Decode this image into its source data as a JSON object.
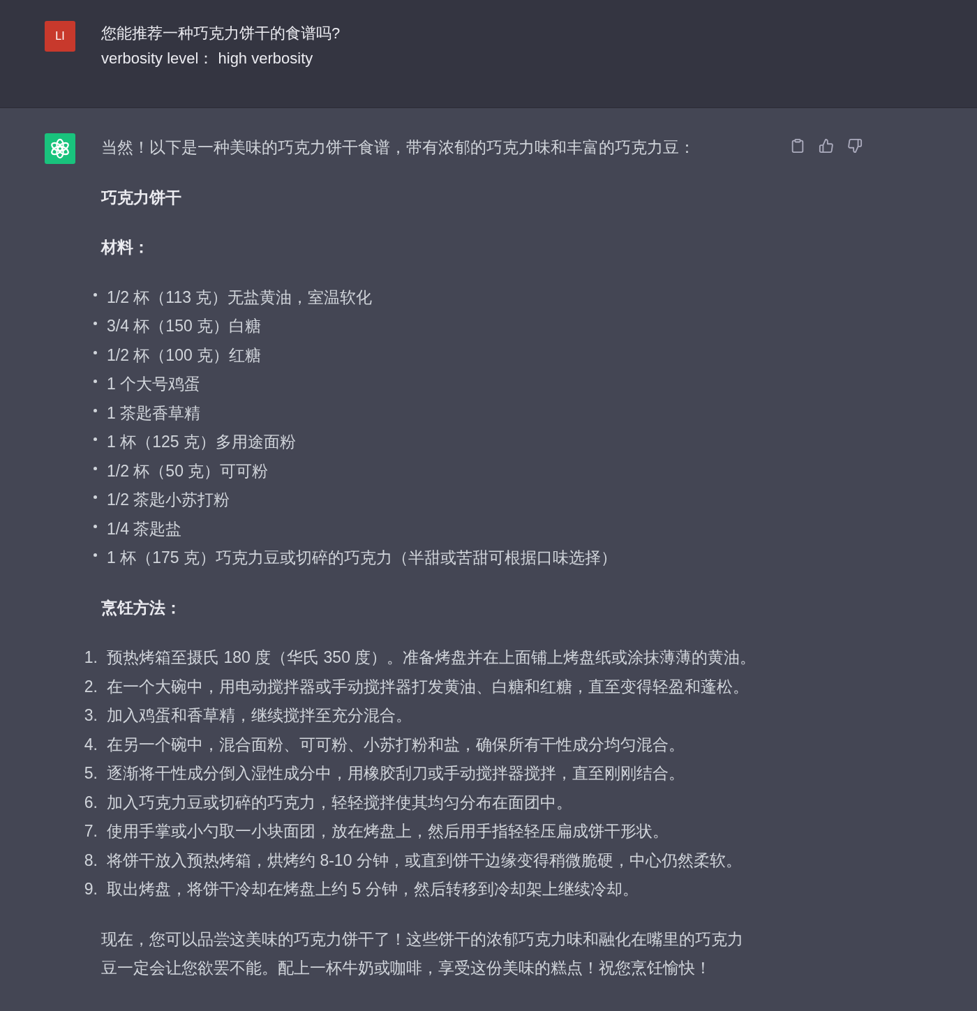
{
  "user_message": {
    "avatar_initials": "LI",
    "lines": [
      "您能推荐一种巧克力饼干的食谱吗?",
      "verbosity level： high verbosity"
    ]
  },
  "assistant_message": {
    "intro": "当然！以下是一种美味的巧克力饼干食谱，带有浓郁的巧克力味和丰富的巧克力豆：",
    "title": "巧克力饼干",
    "ingredients_heading": "材料：",
    "ingredients": [
      "1/2 杯（113 克）无盐黄油，室温软化",
      "3/4 杯（150 克）白糖",
      "1/2 杯（100 克）红糖",
      "1 个大号鸡蛋",
      "1 茶匙香草精",
      "1 杯（125 克）多用途面粉",
      "1/2 杯（50 克）可可粉",
      "1/2 茶匙小苏打粉",
      "1/4 茶匙盐",
      "1 杯（175 克）巧克力豆或切碎的巧克力（半甜或苦甜可根据口味选择）"
    ],
    "method_heading": "烹饪方法：",
    "steps": [
      {
        "number": "1.",
        "text": "预热烤箱至摄氏 180 度（华氏 350 度）。准备烤盘并在上面铺上烤盘纸或涂抹薄薄的黄油。"
      },
      {
        "number": "2.",
        "text": "在一个大碗中，用电动搅拌器或手动搅拌器打发黄油、白糖和红糖，直至变得轻盈和蓬松。"
      },
      {
        "number": "3.",
        "text": "加入鸡蛋和香草精，继续搅拌至充分混合。"
      },
      {
        "number": "4.",
        "text": "在另一个碗中，混合面粉、可可粉、小苏打粉和盐，确保所有干性成分均匀混合。"
      },
      {
        "number": "5.",
        "text": "逐渐将干性成分倒入湿性成分中，用橡胶刮刀或手动搅拌器搅拌，直至刚刚结合。"
      },
      {
        "number": "6.",
        "text": "加入巧克力豆或切碎的巧克力，轻轻搅拌使其均匀分布在面团中。"
      },
      {
        "number": "7.",
        "text": "使用手掌或小勺取一小块面团，放在烤盘上，然后用手指轻轻压扁成饼干形状。"
      },
      {
        "number": "8.",
        "text": "将饼干放入预热烤箱，烘烤约 8-10 分钟，或直到饼干边缘变得稍微脆硬，中心仍然柔软。"
      },
      {
        "number": "9.",
        "text": "取出烤盘，将饼干冷却在烤盘上约 5 分钟，然后转移到冷却架上继续冷却。"
      }
    ],
    "closing": "现在，您可以品尝这美味的巧克力饼干了！这些饼干的浓郁巧克力味和融化在嘴里的巧克力豆一定会让您欲罢不能。配上一杯牛奶或咖啡，享受这份美味的糕点！祝您烹饪愉快！"
  }
}
